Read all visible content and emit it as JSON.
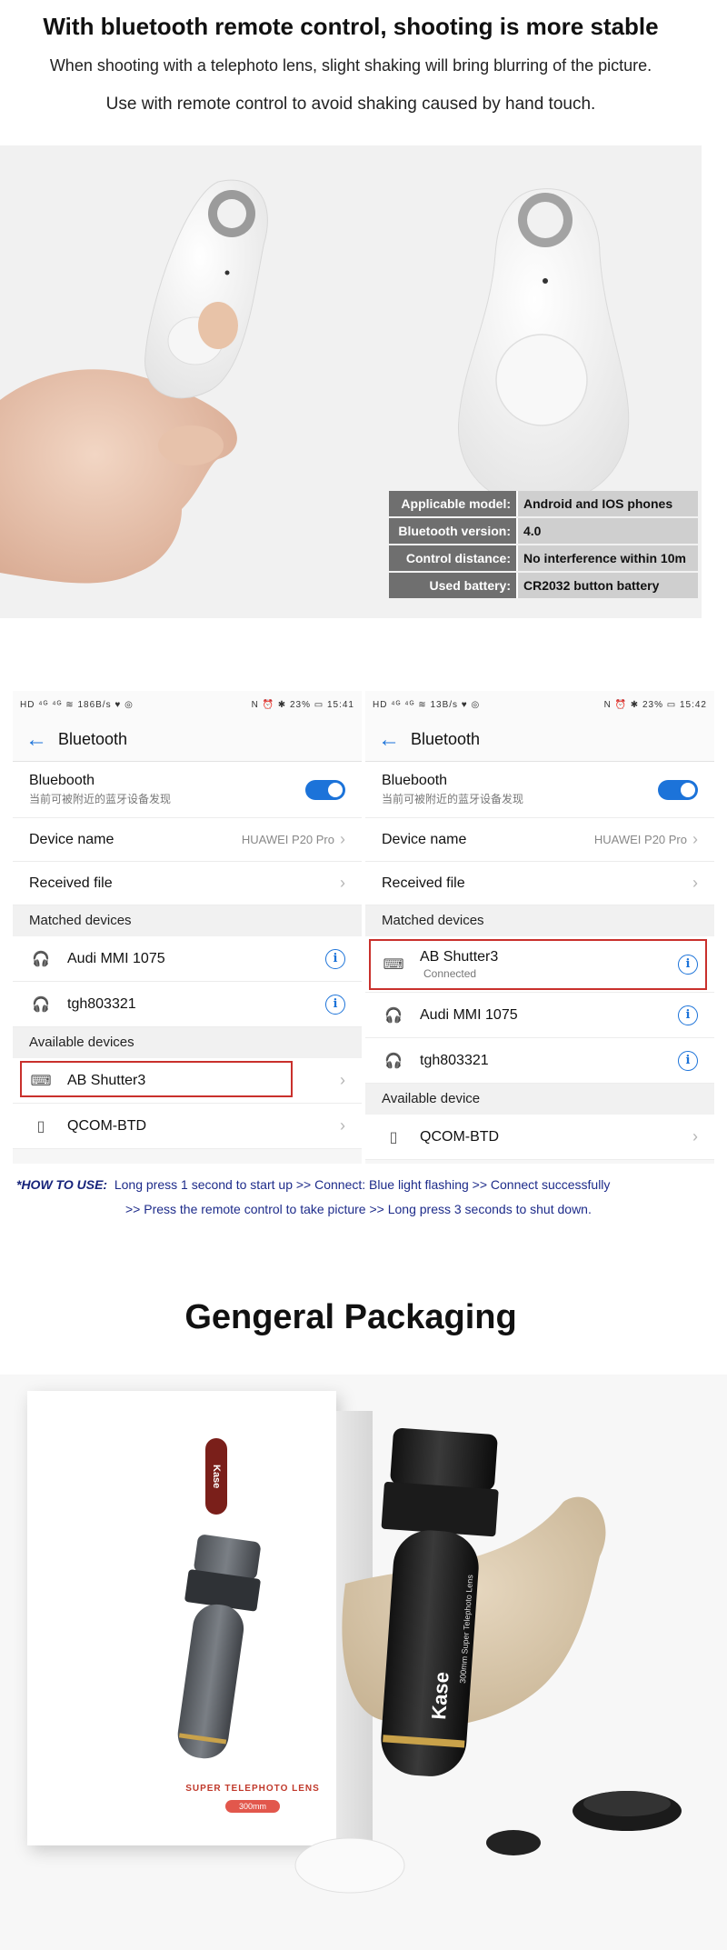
{
  "header": {
    "title": "With bluetooth remote control, shooting is more stable",
    "line1": "When shooting with a telephoto lens, slight shaking will bring blurring of the picture.",
    "line2": "Use with remote control to avoid shaking caused by hand touch."
  },
  "specs": [
    {
      "label": "Applicable model:",
      "value": "Android and IOS phones"
    },
    {
      "label": "Bluetooth version:",
      "value": "4.0"
    },
    {
      "label": "Control distance:",
      "value": "No interference within 10m"
    },
    {
      "label": "Used battery:",
      "value": "CR2032 button battery"
    }
  ],
  "screen_left": {
    "status_left": "HD ⁴ᴳ ⁴ᴳ ≋ 186B/s ♥ ◎",
    "status_right": "N ⏰ ✱ 23% ▭ 15:41",
    "title": "Bluetooth",
    "bluetooth_label": "Bluebooth",
    "bluetooth_sub": "当前可被附近的蓝牙设备发现",
    "device_name_label": "Device name",
    "device_name_value": "HUAWEI P20 Pro",
    "received_file_label": "Received file",
    "matched_section": "Matched devices",
    "matched": [
      {
        "name": "Audi MMI 1075",
        "icon": "headset-icon"
      },
      {
        "name": "tgh803321",
        "icon": "headset-icon"
      }
    ],
    "available_section": "Available devices",
    "available": [
      {
        "name": "AB Shutter3",
        "icon": "keyboard-icon"
      },
      {
        "name": "QCOM-BTD",
        "icon": "phone-icon"
      }
    ]
  },
  "screen_right": {
    "status_left": "HD ⁴ᴳ ⁴ᴳ ≋ 13B/s ♥ ◎",
    "status_right": "N ⏰ ✱ 23% ▭ 15:42",
    "title": "Bluetooth",
    "bluetooth_label": "Bluebooth",
    "bluetooth_sub": "当前可被附近的蓝牙设备发现",
    "device_name_label": "Device name",
    "device_name_value": "HUAWEI P20 Pro",
    "received_file_label": "Received file",
    "matched_section": "Matched devices",
    "matched": [
      {
        "name": "AB Shutter3",
        "status": "Connected",
        "icon": "keyboard-icon"
      },
      {
        "name": "Audi MMI 1075",
        "icon": "headset-icon"
      },
      {
        "name": "tgh803321",
        "icon": "headset-icon"
      }
    ],
    "available_section": "Available device",
    "available": [
      {
        "name": "QCOM-BTD",
        "icon": "phone-icon"
      }
    ]
  },
  "howto": {
    "label": "*HOW TO USE:",
    "line1": "Long press 1 second to start up >> Connect: Blue light flashing >> Connect successfully",
    "line2": ">> Press the remote control to take picture >> Long press 3 seconds to shut down."
  },
  "packaging": {
    "title": "Gengeral Packaging",
    "box_brand": "Kase",
    "box_text": "SUPER TELEPHOTO LENS",
    "box_badge": "300mm",
    "lens_text": "300mm Super Telephoto Lens",
    "lens_brand": "Kase"
  },
  "colors": {
    "accent_blue": "#1c73d9",
    "highlight_red": "#c9302c",
    "howto_blue": "#1d2b8a"
  }
}
